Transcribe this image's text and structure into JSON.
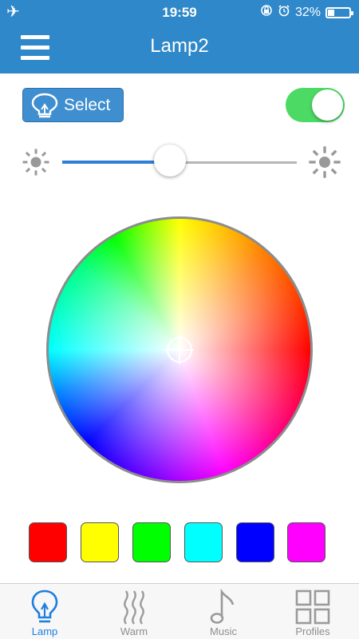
{
  "status_bar": {
    "time": "19:59",
    "battery": "32%",
    "battery_level": 0.32
  },
  "nav": {
    "title": "Lamp2",
    "menu_icon": "hamburger-icon"
  },
  "controls": {
    "select_label": "Select",
    "select_icon": "bulb-icon",
    "power_on": true,
    "brightness": 0.46,
    "accent_color": "#2f88c9"
  },
  "color_wheel": {
    "selected": "center-white"
  },
  "presets": [
    "#ff0000",
    "#ffff00",
    "#00ff00",
    "#00ffff",
    "#0000ff",
    "#ff00ff"
  ],
  "tabs": [
    {
      "label": "Lamp",
      "icon": "bulb-icon",
      "active": true
    },
    {
      "label": "Warm",
      "icon": "heat-waves-icon",
      "active": false
    },
    {
      "label": "Music",
      "icon": "music-note-icon",
      "active": false
    },
    {
      "label": "Profiles",
      "icon": "grid-icon",
      "active": false
    }
  ]
}
